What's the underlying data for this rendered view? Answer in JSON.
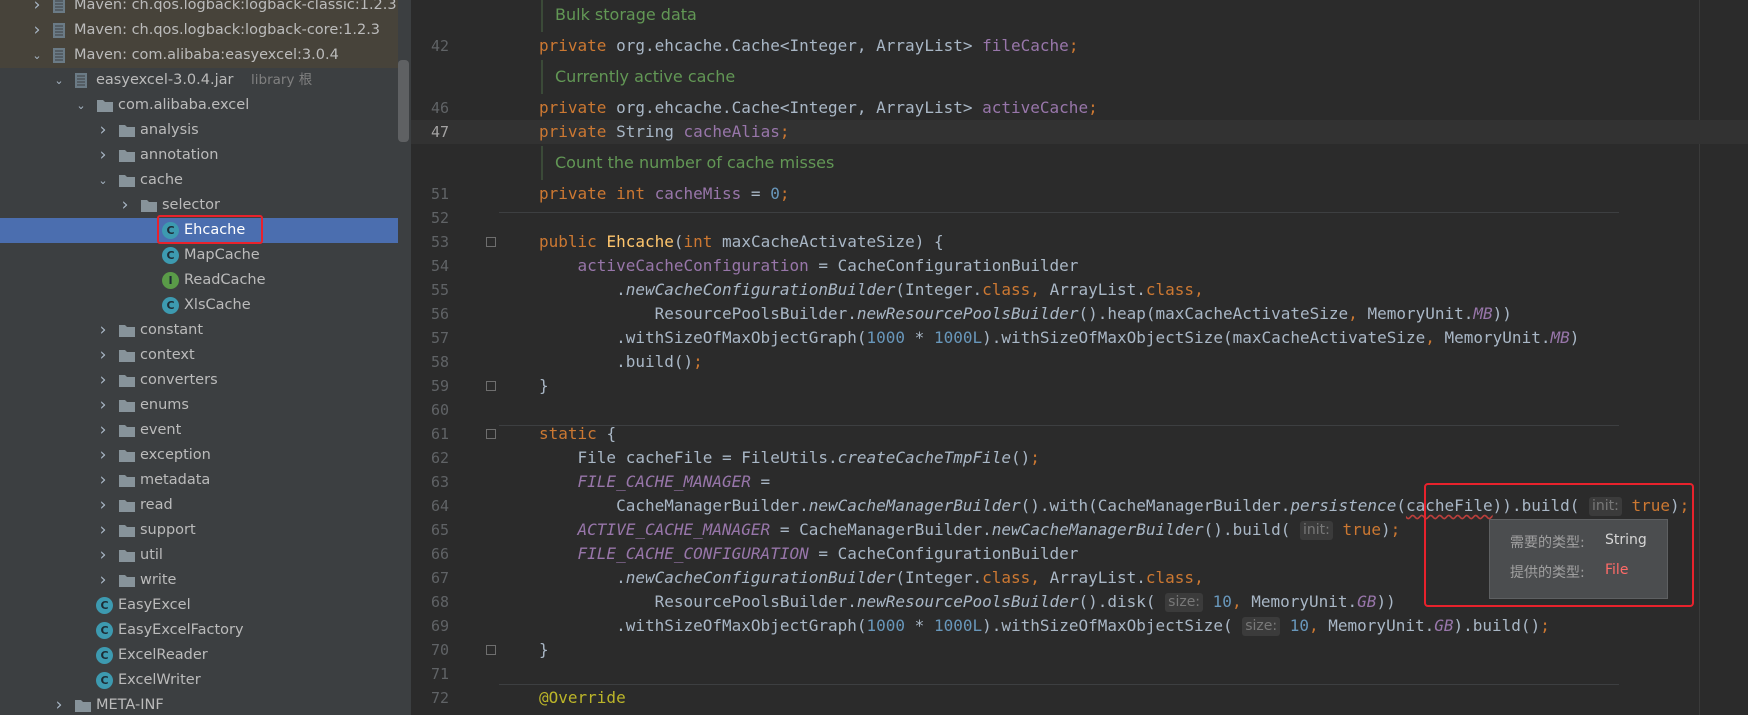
{
  "tree": {
    "nodes": [
      {
        "label": "Maven: ch.qos.logback:logback-classic:1.2.3",
        "type": "lib",
        "expanded": false
      },
      {
        "label": "Maven: ch.qos.logback:logback-core:1.2.3",
        "type": "lib",
        "expanded": false
      },
      {
        "label": "Maven: com.alibaba:easyexcel:3.0.4",
        "type": "lib",
        "expanded": true
      },
      {
        "label": "easyexcel-3.0.4.jar",
        "note": "library 根",
        "type": "jar",
        "expanded": true
      },
      {
        "label": "com.alibaba.excel",
        "type": "package",
        "expanded": true
      },
      {
        "label": "analysis",
        "type": "package",
        "expanded": false
      },
      {
        "label": "annotation",
        "type": "package",
        "expanded": false
      },
      {
        "label": "cache",
        "type": "package",
        "expanded": true
      },
      {
        "label": "selector",
        "type": "package",
        "expanded": false
      },
      {
        "label": "Ehcache",
        "type": "class",
        "selected": true
      },
      {
        "label": "MapCache",
        "type": "class"
      },
      {
        "label": "ReadCache",
        "type": "interface"
      },
      {
        "label": "XlsCache",
        "type": "class"
      },
      {
        "label": "constant",
        "type": "package",
        "expanded": false
      },
      {
        "label": "context",
        "type": "package",
        "expanded": false
      },
      {
        "label": "converters",
        "type": "package",
        "expanded": false
      },
      {
        "label": "enums",
        "type": "package",
        "expanded": false
      },
      {
        "label": "event",
        "type": "package",
        "expanded": false
      },
      {
        "label": "exception",
        "type": "package",
        "expanded": false
      },
      {
        "label": "metadata",
        "type": "package",
        "expanded": false
      },
      {
        "label": "read",
        "type": "package",
        "expanded": false
      },
      {
        "label": "support",
        "type": "package",
        "expanded": false
      },
      {
        "label": "util",
        "type": "package",
        "expanded": false
      },
      {
        "label": "write",
        "type": "package",
        "expanded": false
      },
      {
        "label": "EasyExcel",
        "type": "class"
      },
      {
        "label": "EasyExcelFactory",
        "type": "class"
      },
      {
        "label": "ExcelReader",
        "type": "class"
      },
      {
        "label": "ExcelWriter",
        "type": "class"
      },
      {
        "label": "META-INF",
        "type": "folder",
        "expanded": false
      }
    ]
  },
  "editor": {
    "current_line": "47",
    "docs": [
      "Bulk storage data",
      "Currently active cache",
      "Count the number of cache misses"
    ],
    "line_numbers": [
      "42",
      "46",
      "47",
      "51",
      "52",
      "53",
      "54",
      "55",
      "56",
      "57",
      "58",
      "59",
      "60",
      "61",
      "62",
      "63",
      "64",
      "65",
      "66",
      "67",
      "68",
      "69",
      "70",
      "71",
      "72"
    ],
    "lines": {
      "l42": [
        [
          "kw",
          "private "
        ],
        [
          "",
          "org.ehcache.Cache<Integer, ArrayList> "
        ],
        [
          "fld",
          "fileCache"
        ],
        [
          "kw",
          ";"
        ]
      ],
      "l46": [
        [
          "kw",
          "private "
        ],
        [
          "",
          "org.ehcache.Cache<Integer, ArrayList> "
        ],
        [
          "fld",
          "activeCache"
        ],
        [
          "kw",
          ";"
        ]
      ],
      "l47": [
        [
          "kw",
          "private "
        ],
        [
          "",
          "String "
        ],
        [
          "fld",
          "cacheAlias"
        ],
        [
          "kw",
          ";"
        ]
      ],
      "l51": [
        [
          "kw",
          "private int "
        ],
        [
          "fld",
          "cacheMiss"
        ],
        [
          "",
          " = "
        ],
        [
          "num",
          "0"
        ],
        [
          "kw",
          ";"
        ]
      ],
      "l52": [],
      "l53": [
        [
          "kw",
          "public "
        ],
        [
          "cls",
          "Ehcache"
        ],
        [
          "",
          "("
        ],
        [
          "kw",
          "int "
        ],
        [
          "",
          "maxCacheActivateSize) {"
        ]
      ],
      "l54": [
        [
          "",
          "    "
        ],
        [
          "fld",
          "activeCacheConfiguration"
        ],
        [
          "",
          " = CacheConfigurationBuilder"
        ]
      ],
      "l55": [
        [
          "",
          "        ."
        ],
        [
          "mth",
          "newCacheConfigurationBuilder"
        ],
        [
          "",
          "(Integer."
        ],
        [
          "kw",
          "class"
        ],
        [
          "kw",
          ", "
        ],
        [
          "",
          "ArrayList."
        ],
        [
          "kw",
          "class"
        ],
        [
          "kw",
          ","
        ]
      ],
      "l56": [
        [
          "",
          "            ResourcePoolsBuilder."
        ],
        [
          "mth",
          "newResourcePoolsBuilder"
        ],
        [
          "",
          "().heap(maxCacheActivateSize"
        ],
        [
          "kw",
          ", "
        ],
        [
          "",
          "MemoryUnit."
        ],
        [
          "sfld",
          "MB"
        ],
        [
          "",
          "))"
        ]
      ],
      "l57": [
        [
          "",
          "        .withSizeOfMaxObjectGraph("
        ],
        [
          "num",
          "1000"
        ],
        [
          "",
          " * "
        ],
        [
          "num",
          "1000L"
        ],
        [
          "",
          ").withSizeOfMaxObjectSize(maxCacheActivateSize"
        ],
        [
          "kw",
          ", "
        ],
        [
          "",
          "MemoryUnit."
        ],
        [
          "sfld",
          "MB"
        ],
        [
          "",
          ")"
        ]
      ],
      "l58": [
        [
          "",
          "        .build()"
        ],
        [
          "kw",
          ";"
        ]
      ],
      "l59": [
        [
          "",
          "}"
        ]
      ],
      "l60": [],
      "l61": [
        [
          "kw",
          "static "
        ],
        [
          "",
          "{"
        ]
      ],
      "l62": [
        [
          "",
          "    File cacheFile = FileUtils."
        ],
        [
          "mth",
          "createCacheTmpFile"
        ],
        [
          "",
          "()"
        ],
        [
          "kw",
          ";"
        ]
      ],
      "l63": [
        [
          "",
          "    "
        ],
        [
          "sfld",
          "FILE_CACHE_MANAGER"
        ],
        [
          "",
          " ="
        ]
      ],
      "l64": [
        [
          "",
          "        CacheManagerBuilder."
        ],
        [
          "mth",
          "newCacheManagerBuilder"
        ],
        [
          "",
          "().with(CacheManagerBuilder."
        ],
        [
          "mth",
          "persistence"
        ],
        [
          "",
          "("
        ],
        [
          "err",
          "cacheFile"
        ],
        [
          "",
          ")).build( "
        ],
        [
          "hint",
          "init:"
        ],
        [
          "kw",
          " true"
        ],
        [
          "",
          ")"
        ],
        [
          "kw",
          ";"
        ]
      ],
      "l65": [
        [
          "",
          "    "
        ],
        [
          "sfld",
          "ACTIVE_CACHE_MANAGER"
        ],
        [
          "",
          " = CacheManagerBuilder."
        ],
        [
          "mth",
          "newCacheManagerBuilder"
        ],
        [
          "",
          "().build( "
        ],
        [
          "hint",
          "init:"
        ],
        [
          "kw",
          " true"
        ],
        [
          "",
          ")"
        ],
        [
          "kw",
          ";"
        ]
      ],
      "l66": [
        [
          "",
          "    "
        ],
        [
          "sfld",
          "FILE_CACHE_CONFIGURATION"
        ],
        [
          "",
          " = CacheConfigurationBuilder"
        ]
      ],
      "l67": [
        [
          "",
          "        ."
        ],
        [
          "mth",
          "newCacheConfigurationBuilder"
        ],
        [
          "",
          "(Integer."
        ],
        [
          "kw",
          "class"
        ],
        [
          "kw",
          ", "
        ],
        [
          "",
          "ArrayList."
        ],
        [
          "kw",
          "class"
        ],
        [
          "kw",
          ","
        ]
      ],
      "l68": [
        [
          "",
          "            ResourcePoolsBuilder."
        ],
        [
          "mth",
          "newResourcePoolsBuilder"
        ],
        [
          "",
          "().disk( "
        ],
        [
          "hint",
          "size:"
        ],
        [
          "num",
          " 10"
        ],
        [
          "kw",
          ", "
        ],
        [
          "",
          "MemoryUnit."
        ],
        [
          "sfld",
          "GB"
        ],
        [
          "",
          "))"
        ]
      ],
      "l69": [
        [
          "",
          "        .withSizeOfMaxObjectGraph("
        ],
        [
          "num",
          "1000"
        ],
        [
          "",
          " * "
        ],
        [
          "num",
          "1000L"
        ],
        [
          "",
          ").withSizeOfMaxObjectSize( "
        ],
        [
          "hint",
          "size:"
        ],
        [
          "num",
          " 10"
        ],
        [
          "kw",
          ", "
        ],
        [
          "",
          "MemoryUnit."
        ],
        [
          "sfld",
          "GB"
        ],
        [
          "",
          ").build()"
        ],
        [
          "kw",
          ";"
        ]
      ],
      "l70": [
        [
          "",
          "}"
        ]
      ],
      "l71": [],
      "l72": [
        [
          "ann",
          "@Override"
        ]
      ]
    }
  },
  "tooltip": {
    "required_label": "需要的类型:",
    "required_value": "String",
    "provided_label": "提供的类型:",
    "provided_value": "File"
  },
  "colors": {
    "accent_selection": "#4b6eaf",
    "annotation_box": "#e8222c",
    "keyword": "#cc7832",
    "field": "#9876aa",
    "doc_comment": "#629755"
  }
}
